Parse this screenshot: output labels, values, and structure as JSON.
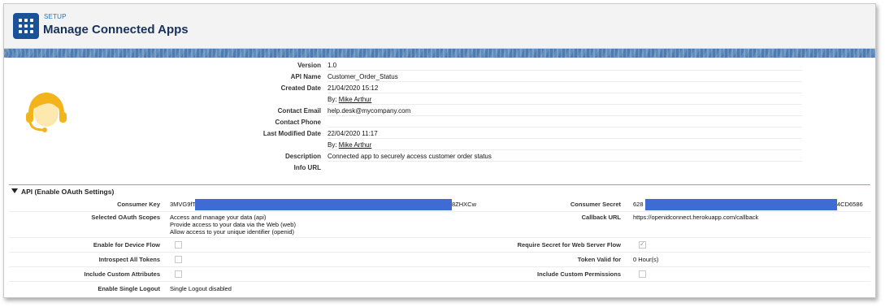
{
  "header": {
    "setup_label": "SETUP",
    "title": "Manage Connected Apps",
    "app_icon": "app-launcher-grid-icon"
  },
  "app_info": {
    "avatar_icon": "support-headset-avatar-icon",
    "rows": [
      {
        "label": "Version",
        "value": "1.0"
      },
      {
        "label": "API Name",
        "value": "Customer_Order_Status"
      },
      {
        "label": "Created Date",
        "value": "21/04/2020 15:12"
      },
      {
        "label": "",
        "by_prefix": "By:",
        "value": "Mike Arthur"
      },
      {
        "label": "Contact Email",
        "value": "help.desk@mycompany.com"
      },
      {
        "label": "Contact Phone",
        "value": ""
      },
      {
        "label": "Last Modified Date",
        "value": "22/04/2020 11:17"
      },
      {
        "label": "",
        "by_prefix": "By:",
        "value": "Mike Arthur"
      },
      {
        "label": "Description",
        "value": "Connected app to securely access customer order status"
      },
      {
        "label": "Info URL",
        "value": ""
      }
    ]
  },
  "oauth": {
    "section_title": "API (Enable OAuth Settings)",
    "consumer_key_label": "Consumer Key",
    "consumer_key_start": "3MVG9fTL",
    "consumer_key_end": "8ZHXCw",
    "consumer_secret_label": "Consumer Secret",
    "consumer_secret_start": "628",
    "consumer_secret_end": "4CD6586",
    "redaction_color": "#3f6cd4",
    "scopes_label": "Selected OAuth Scopes",
    "scopes": [
      "Access and manage your data (api)",
      "Provide access to your data via the Web (web)",
      "Allow access to your unique identifier (openid)"
    ],
    "callback_label": "Callback URL",
    "callback_value": "https://openidconnect.herokuapp.com/callback",
    "device_flow_label": "Enable for Device Flow",
    "device_flow_checked": false,
    "require_secret_label": "Require Secret for Web Server Flow",
    "require_secret_checked": true,
    "introspect_label": "Introspect All Tokens",
    "introspect_checked": false,
    "token_valid_label": "Token Valid for",
    "token_valid_value": "0 Hour(s)",
    "custom_attrs_label": "Include Custom Attributes",
    "custom_attrs_checked": false,
    "custom_perms_label": "Include Custom Permissions",
    "custom_perms_checked": false,
    "single_logout_label": "Enable Single Logout",
    "single_logout_value": "Single Logout disabled"
  },
  "colors": {
    "brand_blue": "#1b5297",
    "title_navy": "#16325c",
    "setup_link": "#2a6fbf",
    "avatar_yellow": "#f3b41b"
  }
}
